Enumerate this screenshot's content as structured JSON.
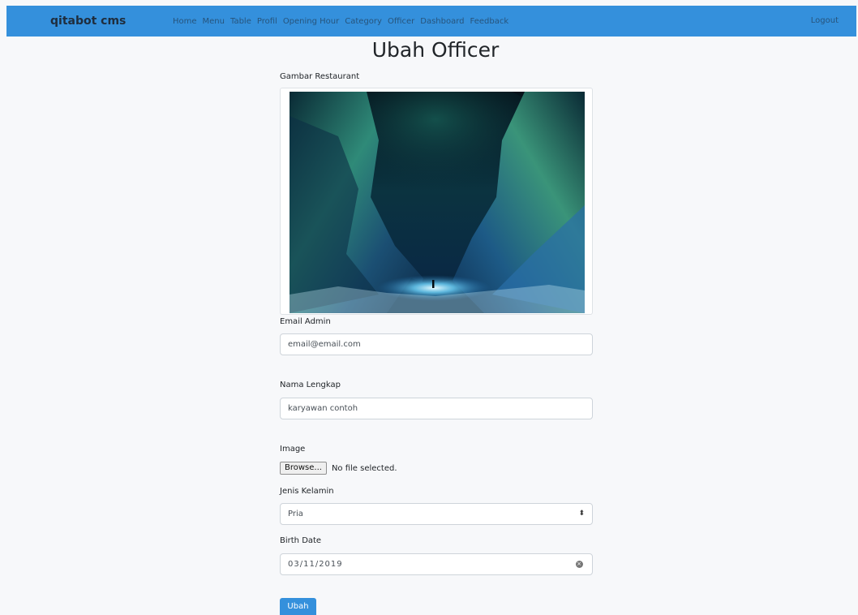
{
  "navbar": {
    "brand": "qitabot cms",
    "links": [
      "Home",
      "Menu",
      "Table",
      "Profil",
      "Opening Hour",
      "Category",
      "Officer",
      "Dashboard",
      "Feedback"
    ],
    "logout": "Logout",
    "color": "#3490dc"
  },
  "page": {
    "title": "Ubah Officer"
  },
  "form": {
    "image_label": "Gambar Restaurant",
    "email_label": "Email Admin",
    "email_value": "email@email.com",
    "name_label": "Nama Lengkap",
    "name_value": "karyawan contoh",
    "file_label": "Image",
    "browse_label": "Browse...",
    "file_status": "No file selected.",
    "gender_label": "Jenis Kelamin",
    "gender_value": "Pria",
    "birth_label": "Birth Date",
    "birth_value": "03/11/2019",
    "submit_label": "Ubah"
  },
  "icons": {
    "select_arrow": "select-arrow-icon",
    "clear_date": "clear-icon"
  }
}
